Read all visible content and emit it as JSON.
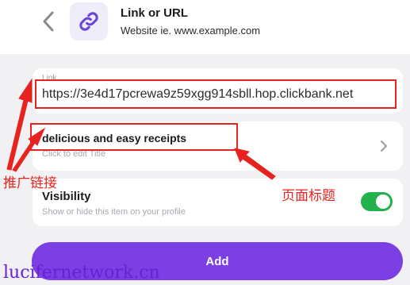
{
  "header": {
    "title": "Link or URL",
    "subtitle": "Website ie. www.example.com",
    "back_icon": "chevron-left-icon",
    "app_icon": "link-icon"
  },
  "link_field": {
    "label": "Link",
    "value": "https://3e4d17pcrewa9z59xgg914sbll.hop.clickbank.net"
  },
  "title_field": {
    "value": "delicious and easy receipts",
    "hint": "Click to edit Title",
    "chevron_icon": "chevron-right-icon"
  },
  "visibility": {
    "label": "Visibility",
    "hint": "Show or hide this item on your profile",
    "enabled": true
  },
  "add_button": {
    "label": "Add"
  },
  "annotations": {
    "promo_link": "推广链接",
    "page_title": "页面标题"
  },
  "watermark": "lucifernetwork.cn",
  "colors": {
    "accent": "#7b3fe4",
    "toggle_on": "#22b14c",
    "annotation": "#e8231f"
  }
}
